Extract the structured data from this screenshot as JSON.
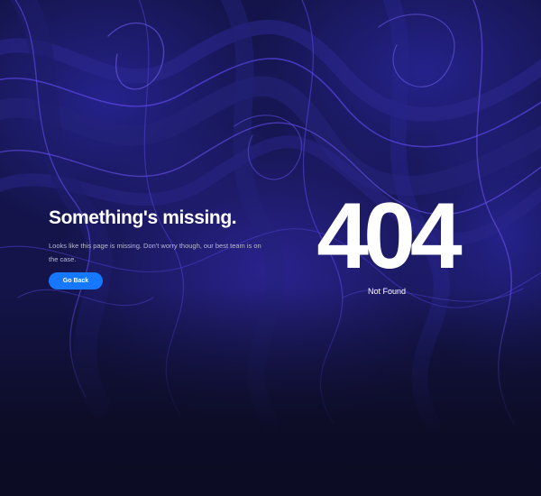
{
  "hero": {
    "heading": "Something's missing.",
    "description": "Looks like this page is missing. Don't worry though, our best team is on the case.",
    "button_label": "Go Back"
  },
  "error": {
    "code": "404",
    "label": "Not Found"
  },
  "colors": {
    "background": "#0c0c24",
    "swirl_base": "#161650",
    "swirl_accent": "#5a46e6",
    "button": "#1677ff",
    "text": "#ffffff",
    "muted_text": "#b9b9d2"
  }
}
